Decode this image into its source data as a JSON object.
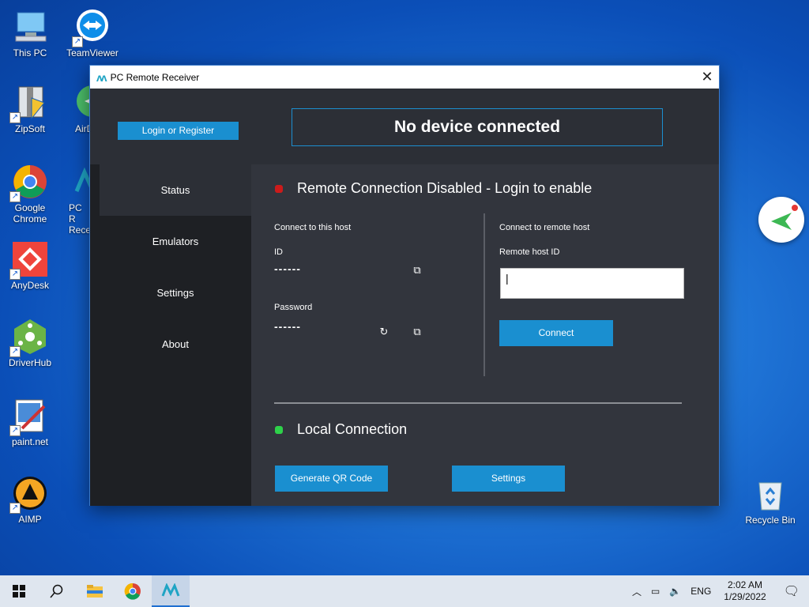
{
  "desktop": {
    "icons": [
      {
        "label": "This PC"
      },
      {
        "label": "TeamViewer"
      },
      {
        "label": "ZipSoft"
      },
      {
        "label": "AirD"
      },
      {
        "label": "Google Chrome"
      },
      {
        "label": "PC R Recei"
      },
      {
        "label": "AnyDesk"
      },
      {
        "label": "DriverHub"
      },
      {
        "label": "paint.net"
      },
      {
        "label": "AIMP"
      },
      {
        "label": "Recycle Bin"
      }
    ]
  },
  "window": {
    "title": "PC Remote Receiver",
    "close_glyph": "✕",
    "login_button": "Login or Register",
    "device_status": "No device connected",
    "nav": [
      {
        "label": "Status"
      },
      {
        "label": "Emulators"
      },
      {
        "label": "Settings"
      },
      {
        "label": "About"
      }
    ],
    "remote_status": "Remote Connection Disabled - Login to enable",
    "remote_status_color": "#cc1b1b",
    "local_heading": {
      "connect_to_this_host": "Connect to this host",
      "id_label": "ID",
      "id_value": "------",
      "password_label": "Password",
      "password_value": "------"
    },
    "remote_heading": {
      "connect_to_remote_host": "Connect to remote host",
      "remote_host_id_label": "Remote host ID",
      "remote_host_id_value": "",
      "connect_button": "Connect"
    },
    "local_connection": "Local Connection",
    "local_connection_color": "#2ed14a",
    "generate_qr_button": "Generate QR Code",
    "settings_button": "Settings",
    "accent_color": "#1a8fd0"
  },
  "taskbar": {
    "language": "ENG",
    "time": "2:02 AM",
    "date": "1/29/2022"
  }
}
